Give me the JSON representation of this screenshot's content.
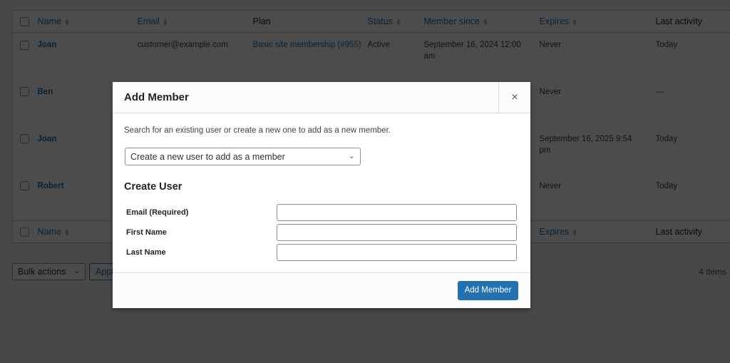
{
  "table": {
    "columns": [
      {
        "label": "Name",
        "sortable": true
      },
      {
        "label": "Email",
        "sortable": true
      },
      {
        "label": "Plan",
        "sortable": false
      },
      {
        "label": "Status",
        "sortable": true
      },
      {
        "label": "Member since",
        "sortable": true
      },
      {
        "label": "Expires",
        "sortable": true
      },
      {
        "label": "Last activity",
        "sortable": false
      }
    ],
    "rows": [
      {
        "name": "Joan",
        "email": "customer@example.com",
        "plan": "Basic site membership (#955)",
        "status": "Active",
        "member_since": "September 16, 2024 12:00 am",
        "expires": "Never",
        "last_activity": "Today"
      },
      {
        "name": "Ben",
        "email": "",
        "plan": "",
        "status": "",
        "member_since": "",
        "expires": "Never",
        "last_activity": "—"
      },
      {
        "name": "Joan",
        "email": "",
        "plan": "",
        "status": "",
        "member_since": "",
        "expires": "September 16, 2025 9:54 pm",
        "last_activity": "Today"
      },
      {
        "name": "Robert",
        "email": "",
        "plan": "",
        "status": "",
        "member_since": "",
        "expires": "Never",
        "last_activity": "Today"
      }
    ],
    "sort_icon": "sort-arrows-icon"
  },
  "tablenav": {
    "bulk_actions_label": "Bulk actions",
    "apply_label": "Apply",
    "items_count": "4 items"
  },
  "modal": {
    "title": "Add Member",
    "close_icon": "×",
    "description": "Search for an existing user or create a new one to add as a new member.",
    "user_select_value": "Create a new user to add as a member",
    "section_title": "Create User",
    "fields": [
      {
        "label": "Email (Required)",
        "value": ""
      },
      {
        "label": "First Name",
        "value": ""
      },
      {
        "label": "Last Name",
        "value": ""
      }
    ],
    "submit_label": "Add Member"
  },
  "colors": {
    "accent": "#2271b1",
    "overlay": "#000000b3"
  }
}
